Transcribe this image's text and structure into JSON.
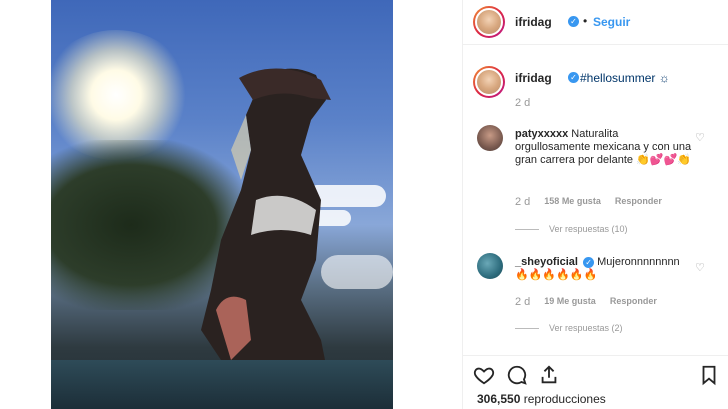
{
  "post": {
    "username": "ifridag",
    "follow_label": "Seguir",
    "dot": "•"
  },
  "caption": {
    "username": "ifridag",
    "text": "#hellosummer ☼",
    "time": "2 d"
  },
  "comments": [
    {
      "username": "patyxxxxx",
      "text": "Naturalita orgullosamente mexicana y con una gran carrera por delante 👏💕💕👏",
      "time": "2 d",
      "likes": "158 Me gusta",
      "reply_label": "Responder",
      "view_replies": "Ver respuestas (10)"
    },
    {
      "username": "_sheyoficial",
      "text": "Mujeronnnnnnnn 🔥🔥🔥🔥🔥🔥",
      "time": "2 d",
      "likes": "19 Me gusta",
      "reply_label": "Responder",
      "view_replies": "Ver respuestas (2)"
    }
  ],
  "footer": {
    "views_count": "306,550",
    "views_label": "reproducciones"
  },
  "icons": [
    "heart-icon",
    "comment-icon",
    "share-icon",
    "bookmark-icon",
    "verified-icon"
  ],
  "colors": {
    "link": "#3897f0",
    "hashtag": "#003569",
    "muted": "#999999"
  }
}
